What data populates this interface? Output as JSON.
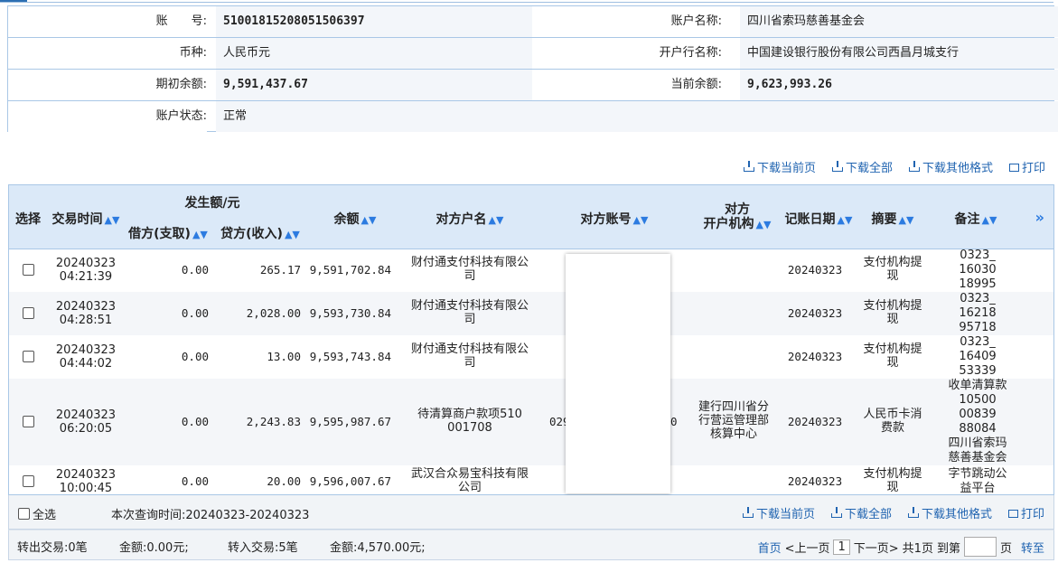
{
  "account_info": {
    "account_no_label": "账　　号:",
    "account_no": "51001815208051506397",
    "account_name_label": "账户名称:",
    "account_name": "四川省索玛慈善基金会",
    "currency_label": "币种:",
    "currency": "人民币元",
    "bank_label": "开户行名称:",
    "bank": "中国建设银行股份有限公司西昌月城支行",
    "opening_balance_label": "期初余额:",
    "opening_balance": "9,591,437.67",
    "current_balance_label": "当前余额:",
    "current_balance": "9,623,993.26",
    "status_label": "账户状态:",
    "status": "正常"
  },
  "actions": {
    "download_page": "下载当前页",
    "download_all": "下载全部",
    "download_other": "下载其他格式",
    "print": "打印"
  },
  "table": {
    "headers": {
      "select": "选择",
      "time": "交易时间",
      "amount_group": "发生额/元",
      "debit": "借方(支取)",
      "credit": "贷方(收入)",
      "balance": "余额",
      "counterparty_name": "对方户名",
      "counterparty_account": "对方账号",
      "counterparty_bank_line1": "对方",
      "counterparty_bank_line2": "开户机构",
      "post_date": "记账日期",
      "summary": "摘要",
      "note": "备注",
      "more": "»"
    },
    "rows": [
      {
        "date": "20240323",
        "time": "04:21:39",
        "debit": "0.00",
        "credit": "265.17",
        "balance": "9,591,702.84",
        "name_l1": "财付通支付科技有限公",
        "name_l2": "司",
        "account": "",
        "bank_l1": "",
        "bank_l2": "",
        "bank_l3": "",
        "post": "20240323",
        "sum_l1": "支付机构提",
        "sum_l2": "现",
        "note_l1": "0323_",
        "note_l2": "16030",
        "note_l3": "18995",
        "note_l4": "",
        "note_l5": "",
        "note_l6": ""
      },
      {
        "date": "20240323",
        "time": "04:28:51",
        "debit": "0.00",
        "credit": "2,028.00",
        "balance": "9,593,730.84",
        "name_l1": "财付通支付科技有限公",
        "name_l2": "司",
        "account": "",
        "bank_l1": "",
        "bank_l2": "",
        "bank_l3": "",
        "post": "20240323",
        "sum_l1": "支付机构提",
        "sum_l2": "现",
        "note_l1": "0323_",
        "note_l2": "16218",
        "note_l3": "95718",
        "note_l4": "",
        "note_l5": "",
        "note_l6": ""
      },
      {
        "date": "20240323",
        "time": "04:44:02",
        "debit": "0.00",
        "credit": "13.00",
        "balance": "9,593,743.84",
        "name_l1": "财付通支付科技有限公",
        "name_l2": "司",
        "account": "",
        "bank_l1": "",
        "bank_l2": "",
        "bank_l3": "",
        "post": "20240323",
        "sum_l1": "支付机构提",
        "sum_l2": "现",
        "note_l1": "0323_",
        "note_l2": "16409",
        "note_l3": "53339",
        "note_l4": "",
        "note_l5": "",
        "note_l6": ""
      },
      {
        "date": "20240323",
        "time": "06:20:05",
        "debit": "0.00",
        "credit": "2,243.83",
        "balance": "9,595,987.67",
        "name_l1": "待清算商户款项510",
        "name_l2": "001708",
        "account_left": "029",
        "account_right": "0",
        "bank_l1": "建行四川省分",
        "bank_l2": "行营运管理部",
        "bank_l3": "核算中心",
        "post": "20240323",
        "sum_l1": "人民币卡消",
        "sum_l2": "费款",
        "note_l1": "收单清算款",
        "note_l2": "10500",
        "note_l3": "00839",
        "note_l4": "88084",
        "note_l5": "四川省索玛",
        "note_l6": "慈善基金会"
      },
      {
        "date": "20240323",
        "time": "10:00:45",
        "debit": "0.00",
        "credit": "20.00",
        "balance": "9,596,007.67",
        "name_l1": "武汉合众易宝科技有限",
        "name_l2": "公司",
        "account": "",
        "bank_l1": "",
        "bank_l2": "",
        "bank_l3": "",
        "post": "20240323",
        "sum_l1": "支付机构提",
        "sum_l2": "现",
        "note_l1": "字节跳动公",
        "note_l2": "益平台",
        "note_l3": "",
        "note_l4": "",
        "note_l5": "",
        "note_l6": ""
      }
    ]
  },
  "footer": {
    "select_all": "全选",
    "query_time": "本次查询时间:20240323-20240323",
    "outgoing": "转出交易:0笔",
    "out_amount": "金额:0.00元;",
    "incoming": "转入交易:5笔",
    "in_amount": "金额:4,570.00元;",
    "first": "首页",
    "prev": "<上一页",
    "page": "1",
    "next": "下一页>",
    "total": "共1页",
    "goto_label": "到第",
    "page_unit": "页",
    "go": "转至"
  }
}
